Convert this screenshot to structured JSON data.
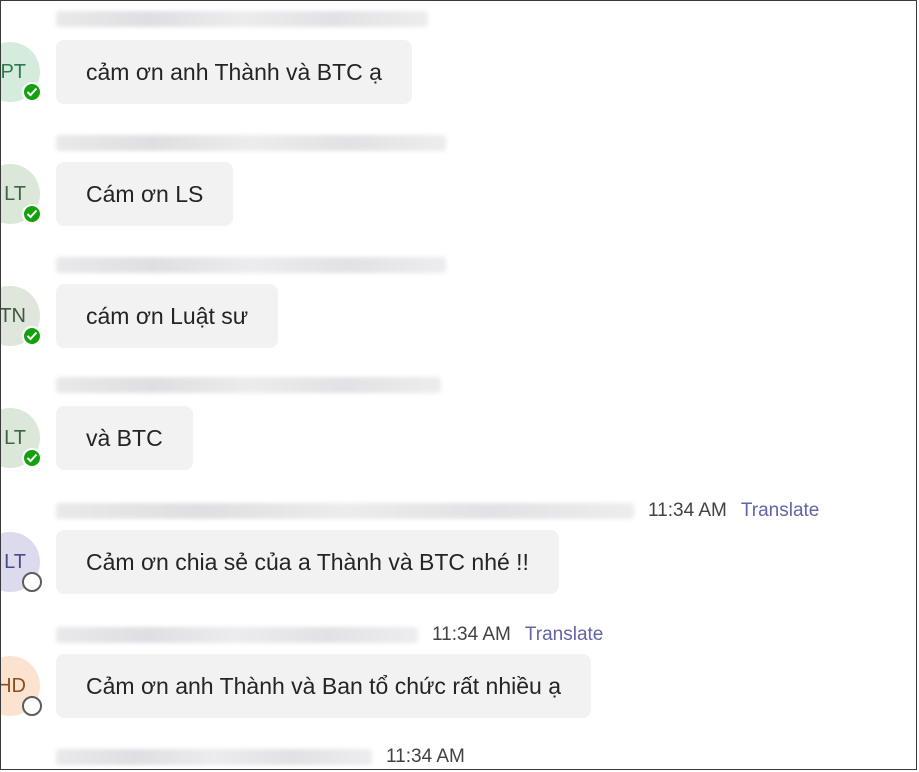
{
  "messages": [
    {
      "initials": "PT",
      "avatar_bg": "#d5ecdd",
      "avatar_fg": "#2f7a4d",
      "status": "online",
      "time": "",
      "translate": "",
      "text": "cảm ơn anh Thành và BTC ạ"
    },
    {
      "initials": "LT",
      "avatar_bg": "#dbe8d9",
      "avatar_fg": "#40634a",
      "status": "online",
      "time": "",
      "translate": "",
      "text": "Cám ơn LS"
    },
    {
      "initials": "TN",
      "avatar_bg": "#dfe6db",
      "avatar_fg": "#41583e",
      "status": "online",
      "time": "",
      "translate": "",
      "text": "cám ơn Luật sư"
    },
    {
      "initials": "LT",
      "avatar_bg": "#dbe8d9",
      "avatar_fg": "#40634a",
      "status": "online",
      "time": "",
      "translate": "",
      "text": "và BTC"
    },
    {
      "initials": "LT",
      "avatar_bg": "#dcdbee",
      "avatar_fg": "#4a4a8a",
      "status": "offline",
      "time": "11:34 AM",
      "translate": "Translate",
      "text": "Cảm ơn chia sẻ của a Thành và BTC nhé !!"
    },
    {
      "initials": "HD",
      "avatar_bg": "#fbe3cf",
      "avatar_fg": "#8a4f22",
      "status": "offline",
      "time": "11:34 AM",
      "translate": "Translate",
      "text": "Cảm ơn anh Thành và Ban tổ chức rất nhiều ạ"
    },
    {
      "initials": "",
      "avatar_bg": "#ffffff",
      "avatar_fg": "#424242",
      "status": "",
      "time": "11:34 AM",
      "translate": "",
      "text": ""
    }
  ],
  "colors": {
    "bubble": "#f2f2f3",
    "translate_link": "#6264a7",
    "online": "#13a10e"
  }
}
